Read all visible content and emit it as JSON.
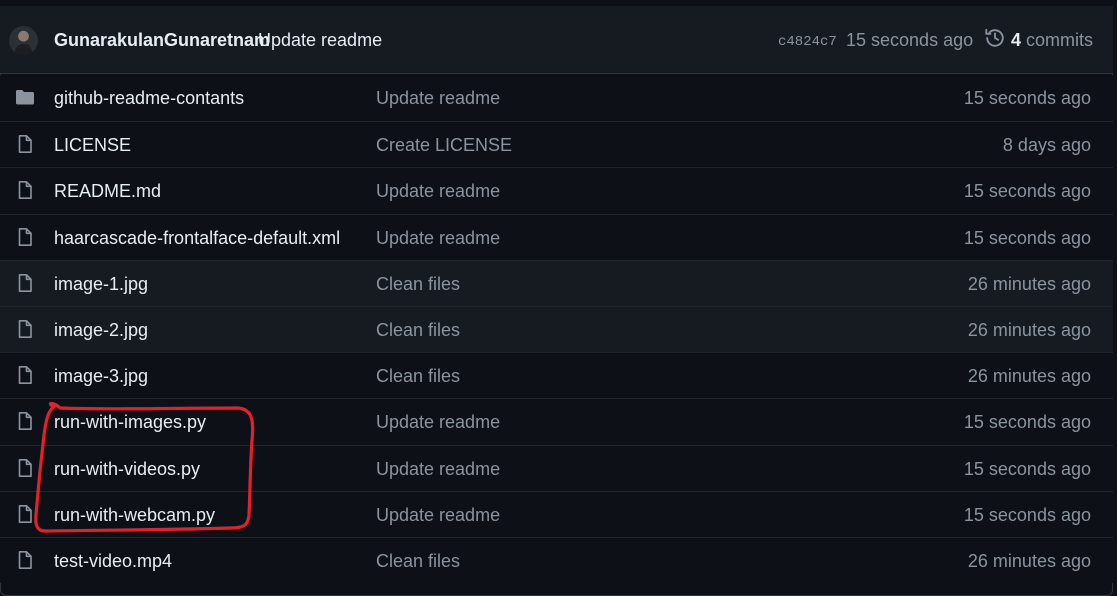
{
  "commit": {
    "author": "GunarakulanGunaretnam",
    "message": "Update readme",
    "sha": "c4824c7",
    "time": "15 seconds ago",
    "commits_count": "4",
    "commits_label": "commits"
  },
  "files": [
    {
      "type": "folder",
      "name": "github-readme-contants",
      "message": "Update readme",
      "time": "15 seconds ago"
    },
    {
      "type": "file",
      "name": "LICENSE",
      "message": "Create LICENSE",
      "time": "8 days ago"
    },
    {
      "type": "file",
      "name": "README.md",
      "message": "Update readme",
      "time": "15 seconds ago"
    },
    {
      "type": "file",
      "name": "haarcascade-frontalface-default.xml",
      "message": "Update readme",
      "time": "15 seconds ago"
    },
    {
      "type": "file",
      "name": "image-1.jpg",
      "message": "Clean files",
      "time": "26 minutes ago"
    },
    {
      "type": "file",
      "name": "image-2.jpg",
      "message": "Clean files",
      "time": "26 minutes ago"
    },
    {
      "type": "file",
      "name": "image-3.jpg",
      "message": "Clean files",
      "time": "26 minutes ago"
    },
    {
      "type": "file",
      "name": "run-with-images.py",
      "message": "Update readme",
      "time": "15 seconds ago"
    },
    {
      "type": "file",
      "name": "run-with-videos.py",
      "message": "Update readme",
      "time": "15 seconds ago"
    },
    {
      "type": "file",
      "name": "run-with-webcam.py",
      "message": "Update readme",
      "time": "15 seconds ago"
    },
    {
      "type": "file",
      "name": "test-video.mp4",
      "message": "Clean files",
      "time": "26 minutes ago"
    }
  ],
  "colors": {
    "background": "#0d1117",
    "header": "#161b22",
    "annotation": "#e5202a"
  }
}
